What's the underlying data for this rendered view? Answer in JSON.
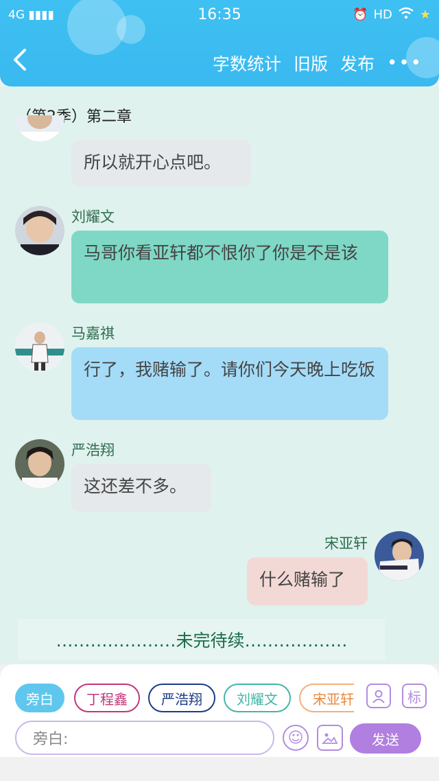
{
  "status_bar": {
    "network": "4G",
    "time": "16:35",
    "hd": "HD"
  },
  "header": {
    "back_icon": "chevron-left-icon",
    "word_count": "字数统计",
    "old_version": "旧版",
    "publish": "发布",
    "more": "•••"
  },
  "chapter_title": "（第2季）第二章",
  "messages": [
    {
      "side": "left",
      "name": "",
      "text": "所以就开心点吧。",
      "color": "#e5e9ec"
    },
    {
      "side": "left",
      "name": "刘耀文",
      "text": "马哥你看亚轩都不恨你了你是不是该",
      "color": "#7fd8c5"
    },
    {
      "side": "left",
      "name": "马嘉祺",
      "text": "行了，我赌输了。请你们今天晚上吃饭",
      "color": "#a4dcf8"
    },
    {
      "side": "left",
      "name": "严浩翔",
      "text": "这还差不多。",
      "color": "#e5e9ec"
    },
    {
      "side": "right",
      "name": "宋亚轩",
      "text": "什么赌输了",
      "color": "#f2d9d6"
    }
  ],
  "narration_text": "…………………未完待续………………",
  "role_chips": [
    {
      "label": "旁白",
      "border": "#5fc7ee",
      "text": "#ffffff",
      "bg": "#5fc7ee"
    },
    {
      "label": "丁程鑫",
      "border": "#c2357a",
      "text": "#c2357a",
      "bg": "#ffffff"
    },
    {
      "label": "严浩翔",
      "border": "#1b3b84",
      "text": "#1b3b84",
      "bg": "#ffffff"
    },
    {
      "label": "刘耀文",
      "border": "#43b5a8",
      "text": "#43b5a8",
      "bg": "#ffffff"
    },
    {
      "label": "宋亚轩",
      "border": "#f2b07a",
      "text": "#e8883a",
      "bg": "#ffffff"
    }
  ],
  "tag_label": "标",
  "input": {
    "placeholder": "旁白:",
    "send_label": "发送"
  }
}
